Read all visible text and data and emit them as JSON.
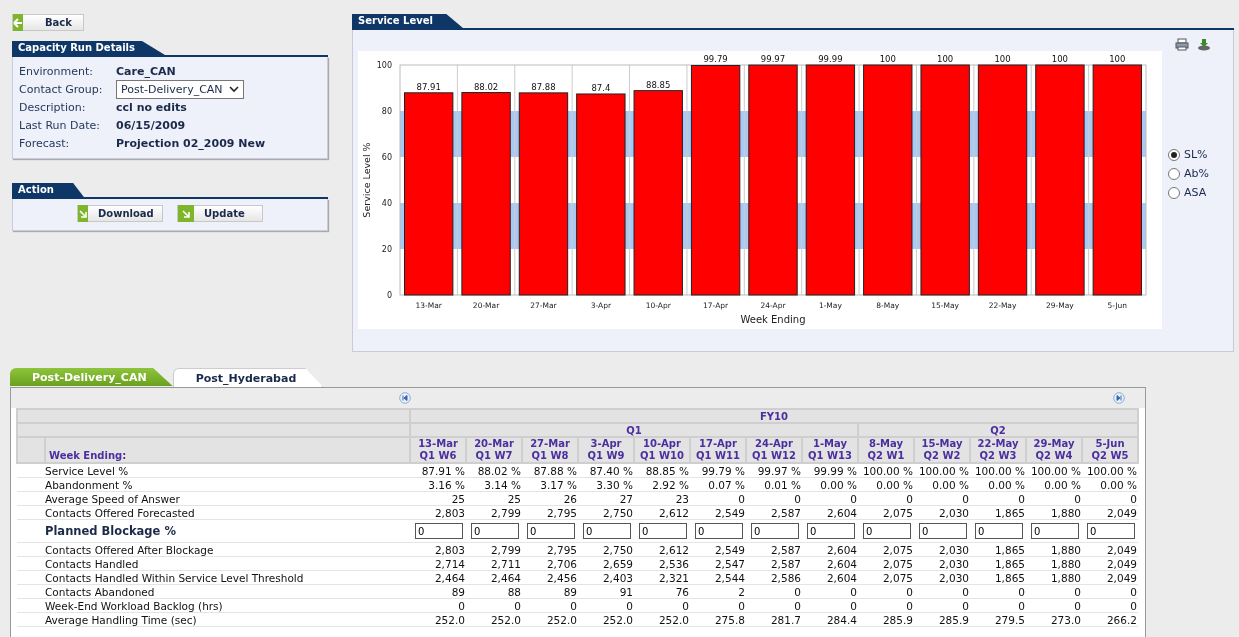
{
  "back_button": {
    "label": "Back"
  },
  "details": {
    "title": "Capacity Run Details",
    "fields": [
      {
        "label": "Environment:",
        "value": "Care_CAN",
        "kind": "text"
      },
      {
        "label": "Contact Group:",
        "value": "Post-Delivery_CAN",
        "kind": "select"
      },
      {
        "label": "Description:",
        "value": "ccl no edits",
        "kind": "text"
      },
      {
        "label": "Last Run Date:",
        "value": "06/15/2009",
        "kind": "text"
      },
      {
        "label": "Forecast:",
        "value": "Projection 02_2009 New",
        "kind": "text"
      }
    ]
  },
  "action": {
    "title": "Action",
    "buttons": [
      "Download",
      "Update"
    ]
  },
  "service_level": {
    "title": "Service Level",
    "chart_data": {
      "type": "bar",
      "xlabel": "Week Ending",
      "ylabel": "Service Level %",
      "categories": [
        "13-Mar",
        "20-Mar",
        "27-Mar",
        "3-Apr",
        "10-Apr",
        "17-Apr",
        "24-Apr",
        "1-May",
        "8-May",
        "15-May",
        "22-May",
        "29-May",
        "5-Jun"
      ],
      "values": [
        87.91,
        88.02,
        87.88,
        87.4,
        88.85,
        99.79,
        99.97,
        99.99,
        100,
        100,
        100,
        100,
        100
      ],
      "value_labels": [
        "87.91",
        "88.02",
        "87.88",
        "87.4",
        "88.85",
        "99.79",
        "99.97",
        "99.99",
        "100",
        "100",
        "100",
        "100",
        "100"
      ],
      "ylim": [
        0,
        100
      ],
      "yticks": [
        0,
        20,
        40,
        60,
        80,
        100
      ],
      "data_labels": true
    },
    "metrics": [
      {
        "label": "SL%",
        "selected": true
      },
      {
        "label": "Ab%",
        "selected": false
      },
      {
        "label": "ASA",
        "selected": false
      }
    ]
  },
  "tabs": [
    {
      "label": "Post-Delivery_CAN",
      "selected": true
    },
    {
      "label": "Post_Hyderabad",
      "selected": false
    }
  ],
  "table": {
    "fiscal_year": "FY10",
    "header_label": "Week Ending:",
    "quarters": [
      {
        "label": "Q1",
        "weeks": [
          {
            "date": "13-Mar",
            "week": "Q1 W6"
          },
          {
            "date": "20-Mar",
            "week": "Q1 W7"
          },
          {
            "date": "27-Mar",
            "week": "Q1 W8"
          },
          {
            "date": "3-Apr",
            "week": "Q1 W9"
          },
          {
            "date": "10-Apr",
            "week": "Q1 W10"
          },
          {
            "date": "17-Apr",
            "week": "Q1 W11"
          },
          {
            "date": "24-Apr",
            "week": "Q1 W12"
          },
          {
            "date": "1-May",
            "week": "Q1 W13"
          }
        ]
      },
      {
        "label": "Q2",
        "weeks": [
          {
            "date": "8-May",
            "week": "Q2 W1"
          },
          {
            "date": "15-May",
            "week": "Q2 W2"
          },
          {
            "date": "22-May",
            "week": "Q2 W3"
          },
          {
            "date": "29-May",
            "week": "Q2 W4"
          },
          {
            "date": "5-Jun",
            "week": "Q2 W5"
          }
        ]
      }
    ],
    "rows": [
      {
        "label": "Service Level %",
        "kind": "value",
        "values": [
          "87.91 %",
          "88.02 %",
          "87.88 %",
          "87.40 %",
          "88.85 %",
          "99.79 %",
          "99.97 %",
          "99.99 %",
          "100.00 %",
          "100.00 %",
          "100.00 %",
          "100.00 %",
          "100.00 %"
        ]
      },
      {
        "label": "Abandonment %",
        "kind": "value",
        "values": [
          "3.16 %",
          "3.14 %",
          "3.17 %",
          "3.30 %",
          "2.92 %",
          "0.07 %",
          "0.01 %",
          "0.00 %",
          "0.00 %",
          "0.00 %",
          "0.00 %",
          "0.00 %",
          "0.00 %"
        ]
      },
      {
        "label": "Average Speed of Answer",
        "kind": "value",
        "values": [
          "25",
          "25",
          "26",
          "27",
          "23",
          "0",
          "0",
          "0",
          "0",
          "0",
          "0",
          "0",
          "0"
        ]
      },
      {
        "label": "Contacts Offered Forecasted",
        "kind": "value",
        "values": [
          "2,803",
          "2,799",
          "2,795",
          "2,750",
          "2,612",
          "2,549",
          "2,587",
          "2,604",
          "2,075",
          "2,030",
          "1,865",
          "1,880",
          "2,049"
        ]
      },
      {
        "label": "Planned Blockage %",
        "kind": "input",
        "values": [
          "0",
          "0",
          "0",
          "0",
          "0",
          "0",
          "0",
          "0",
          "0",
          "0",
          "0",
          "0",
          "0"
        ]
      },
      {
        "label": "Contacts Offered After Blockage",
        "kind": "value",
        "values": [
          "2,803",
          "2,799",
          "2,795",
          "2,750",
          "2,612",
          "2,549",
          "2,587",
          "2,604",
          "2,075",
          "2,030",
          "1,865",
          "1,880",
          "2,049"
        ]
      },
      {
        "label": "Contacts Handled",
        "kind": "value",
        "values": [
          "2,714",
          "2,711",
          "2,706",
          "2,659",
          "2,536",
          "2,547",
          "2,587",
          "2,604",
          "2,075",
          "2,030",
          "1,865",
          "1,880",
          "2,049"
        ]
      },
      {
        "label": "Contacts Handled Within Service Level Threshold",
        "kind": "value",
        "values": [
          "2,464",
          "2,464",
          "2,456",
          "2,403",
          "2,321",
          "2,544",
          "2,586",
          "2,604",
          "2,075",
          "2,030",
          "1,865",
          "1,880",
          "2,049"
        ]
      },
      {
        "label": "Contacts Abandoned",
        "kind": "value",
        "values": [
          "89",
          "88",
          "89",
          "91",
          "76",
          "2",
          "0",
          "0",
          "0",
          "0",
          "0",
          "0",
          "0"
        ]
      },
      {
        "label": "Week-End Workload Backlog (hrs)",
        "kind": "value",
        "values": [
          "0",
          "0",
          "0",
          "0",
          "0",
          "0",
          "0",
          "0",
          "0",
          "0",
          "0",
          "0",
          "0"
        ]
      },
      {
        "label": "Average Handling Time (sec)",
        "kind": "value",
        "values": [
          "252.0",
          "252.0",
          "252.0",
          "252.0",
          "252.0",
          "275.8",
          "281.7",
          "284.4",
          "285.9",
          "285.9",
          "279.5",
          "273.0",
          "266.2"
        ]
      }
    ]
  }
}
